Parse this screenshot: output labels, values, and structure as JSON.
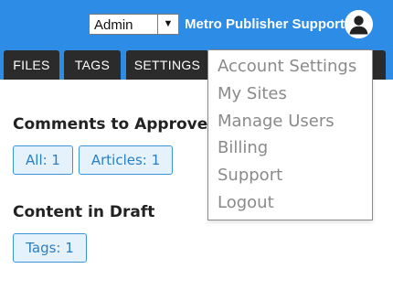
{
  "header": {
    "role_select": {
      "value": "Admin",
      "arrow_icon": "▼"
    },
    "user_name": "Metro Publisher Support",
    "avatar_icon": "user-avatar-icon",
    "brand_color": "#2c8ce6"
  },
  "tabs": [
    {
      "label": "FILES"
    },
    {
      "label": "TAGS"
    },
    {
      "label": "SETTINGS"
    },
    {
      "label": ""
    }
  ],
  "sections": {
    "comments": {
      "title": "Comments to Approve",
      "chips": [
        {
          "label": "All: 1"
        },
        {
          "label": "Articles: 1"
        }
      ]
    },
    "drafts": {
      "title": "Content in Draft",
      "chips": [
        {
          "label": "Tags: 1"
        }
      ]
    }
  },
  "user_menu": {
    "items": [
      {
        "label": "Account Settings"
      },
      {
        "label": "My Sites"
      },
      {
        "label": "Manage Users"
      },
      {
        "label": "Billing"
      },
      {
        "label": "Support"
      },
      {
        "label": "Logout"
      }
    ]
  }
}
